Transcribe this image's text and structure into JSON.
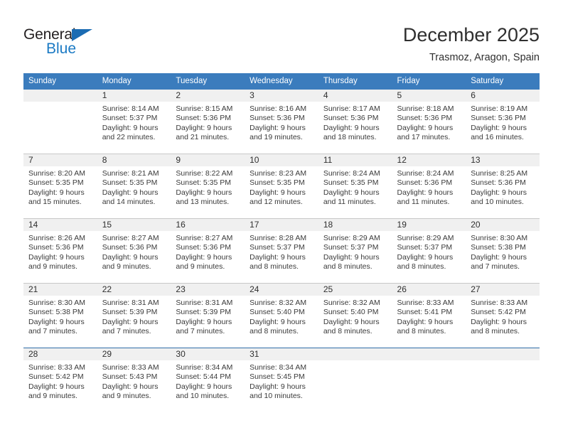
{
  "brand": {
    "name_part1": "General",
    "name_part2": "Blue",
    "triangle_color": "#1b6cb3",
    "blue_color": "#1b7ac4"
  },
  "header": {
    "title": "December 2025",
    "location": "Trasmoz, Aragon, Spain"
  },
  "theme": {
    "header_blue": "#3b7cbd",
    "daynum_band": "#f0f0f0",
    "separator_gray": "#c8c8c8",
    "separator_accent": "#2f6ca8",
    "text_color": "#3a3a3a"
  },
  "weekday_headers": [
    "Sunday",
    "Monday",
    "Tuesday",
    "Wednesday",
    "Thursday",
    "Friday",
    "Saturday"
  ],
  "weeks": [
    {
      "separator": "none",
      "days": [
        {
          "num": "",
          "lines": []
        },
        {
          "num": "1",
          "lines": [
            "Sunrise: 8:14 AM",
            "Sunset: 5:37 PM",
            "Daylight: 9 hours",
            "and 22 minutes."
          ]
        },
        {
          "num": "2",
          "lines": [
            "Sunrise: 8:15 AM",
            "Sunset: 5:36 PM",
            "Daylight: 9 hours",
            "and 21 minutes."
          ]
        },
        {
          "num": "3",
          "lines": [
            "Sunrise: 8:16 AM",
            "Sunset: 5:36 PM",
            "Daylight: 9 hours",
            "and 19 minutes."
          ]
        },
        {
          "num": "4",
          "lines": [
            "Sunrise: 8:17 AM",
            "Sunset: 5:36 PM",
            "Daylight: 9 hours",
            "and 18 minutes."
          ]
        },
        {
          "num": "5",
          "lines": [
            "Sunrise: 8:18 AM",
            "Sunset: 5:36 PM",
            "Daylight: 9 hours",
            "and 17 minutes."
          ]
        },
        {
          "num": "6",
          "lines": [
            "Sunrise: 8:19 AM",
            "Sunset: 5:36 PM",
            "Daylight: 9 hours",
            "and 16 minutes."
          ]
        }
      ]
    },
    {
      "separator": "gray",
      "days": [
        {
          "num": "7",
          "lines": [
            "Sunrise: 8:20 AM",
            "Sunset: 5:35 PM",
            "Daylight: 9 hours",
            "and 15 minutes."
          ]
        },
        {
          "num": "8",
          "lines": [
            "Sunrise: 8:21 AM",
            "Sunset: 5:35 PM",
            "Daylight: 9 hours",
            "and 14 minutes."
          ]
        },
        {
          "num": "9",
          "lines": [
            "Sunrise: 8:22 AM",
            "Sunset: 5:35 PM",
            "Daylight: 9 hours",
            "and 13 minutes."
          ]
        },
        {
          "num": "10",
          "lines": [
            "Sunrise: 8:23 AM",
            "Sunset: 5:35 PM",
            "Daylight: 9 hours",
            "and 12 minutes."
          ]
        },
        {
          "num": "11",
          "lines": [
            "Sunrise: 8:24 AM",
            "Sunset: 5:35 PM",
            "Daylight: 9 hours",
            "and 11 minutes."
          ]
        },
        {
          "num": "12",
          "lines": [
            "Sunrise: 8:24 AM",
            "Sunset: 5:36 PM",
            "Daylight: 9 hours",
            "and 11 minutes."
          ]
        },
        {
          "num": "13",
          "lines": [
            "Sunrise: 8:25 AM",
            "Sunset: 5:36 PM",
            "Daylight: 9 hours",
            "and 10 minutes."
          ]
        }
      ]
    },
    {
      "separator": "gray",
      "days": [
        {
          "num": "14",
          "lines": [
            "Sunrise: 8:26 AM",
            "Sunset: 5:36 PM",
            "Daylight: 9 hours",
            "and 9 minutes."
          ]
        },
        {
          "num": "15",
          "lines": [
            "Sunrise: 8:27 AM",
            "Sunset: 5:36 PM",
            "Daylight: 9 hours",
            "and 9 minutes."
          ]
        },
        {
          "num": "16",
          "lines": [
            "Sunrise: 8:27 AM",
            "Sunset: 5:36 PM",
            "Daylight: 9 hours",
            "and 9 minutes."
          ]
        },
        {
          "num": "17",
          "lines": [
            "Sunrise: 8:28 AM",
            "Sunset: 5:37 PM",
            "Daylight: 9 hours",
            "and 8 minutes."
          ]
        },
        {
          "num": "18",
          "lines": [
            "Sunrise: 8:29 AM",
            "Sunset: 5:37 PM",
            "Daylight: 9 hours",
            "and 8 minutes."
          ]
        },
        {
          "num": "19",
          "lines": [
            "Sunrise: 8:29 AM",
            "Sunset: 5:37 PM",
            "Daylight: 9 hours",
            "and 8 minutes."
          ]
        },
        {
          "num": "20",
          "lines": [
            "Sunrise: 8:30 AM",
            "Sunset: 5:38 PM",
            "Daylight: 9 hours",
            "and 7 minutes."
          ]
        }
      ]
    },
    {
      "separator": "gray",
      "days": [
        {
          "num": "21",
          "lines": [
            "Sunrise: 8:30 AM",
            "Sunset: 5:38 PM",
            "Daylight: 9 hours",
            "and 7 minutes."
          ]
        },
        {
          "num": "22",
          "lines": [
            "Sunrise: 8:31 AM",
            "Sunset: 5:39 PM",
            "Daylight: 9 hours",
            "and 7 minutes."
          ]
        },
        {
          "num": "23",
          "lines": [
            "Sunrise: 8:31 AM",
            "Sunset: 5:39 PM",
            "Daylight: 9 hours",
            "and 7 minutes."
          ]
        },
        {
          "num": "24",
          "lines": [
            "Sunrise: 8:32 AM",
            "Sunset: 5:40 PM",
            "Daylight: 9 hours",
            "and 8 minutes."
          ]
        },
        {
          "num": "25",
          "lines": [
            "Sunrise: 8:32 AM",
            "Sunset: 5:40 PM",
            "Daylight: 9 hours",
            "and 8 minutes."
          ]
        },
        {
          "num": "26",
          "lines": [
            "Sunrise: 8:33 AM",
            "Sunset: 5:41 PM",
            "Daylight: 9 hours",
            "and 8 minutes."
          ]
        },
        {
          "num": "27",
          "lines": [
            "Sunrise: 8:33 AM",
            "Sunset: 5:42 PM",
            "Daylight: 9 hours",
            "and 8 minutes."
          ]
        }
      ]
    },
    {
      "separator": "accent",
      "days": [
        {
          "num": "28",
          "lines": [
            "Sunrise: 8:33 AM",
            "Sunset: 5:42 PM",
            "Daylight: 9 hours",
            "and 9 minutes."
          ]
        },
        {
          "num": "29",
          "lines": [
            "Sunrise: 8:33 AM",
            "Sunset: 5:43 PM",
            "Daylight: 9 hours",
            "and 9 minutes."
          ]
        },
        {
          "num": "30",
          "lines": [
            "Sunrise: 8:34 AM",
            "Sunset: 5:44 PM",
            "Daylight: 9 hours",
            "and 10 minutes."
          ]
        },
        {
          "num": "31",
          "lines": [
            "Sunrise: 8:34 AM",
            "Sunset: 5:45 PM",
            "Daylight: 9 hours",
            "and 10 minutes."
          ]
        },
        {
          "num": "",
          "lines": []
        },
        {
          "num": "",
          "lines": []
        },
        {
          "num": "",
          "lines": []
        }
      ]
    }
  ]
}
